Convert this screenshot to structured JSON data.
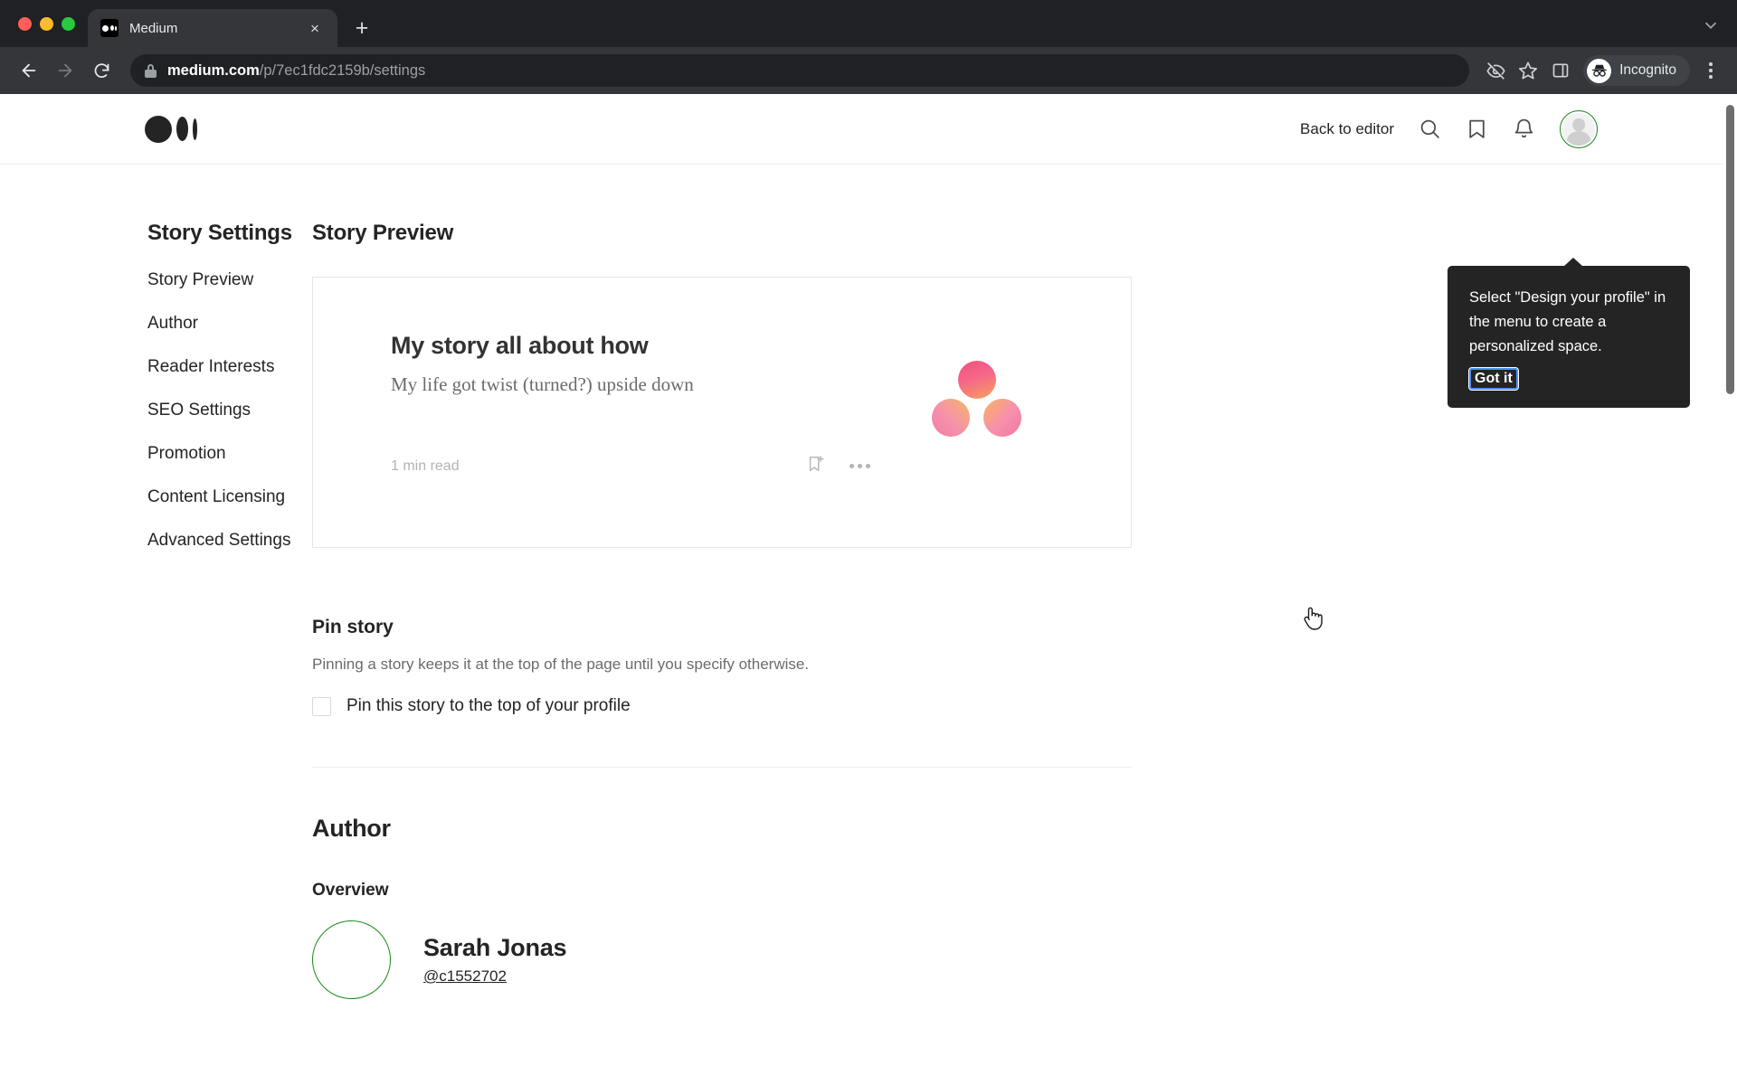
{
  "browser": {
    "tab": {
      "title": "Medium",
      "favicon": "medium-favicon",
      "close": "×"
    },
    "new_tab": "+",
    "tab_list_chevron": "⌄",
    "nav": {
      "back": "←",
      "forward": "→",
      "reload": "⟳"
    },
    "url": {
      "host": "medium.com",
      "path": "/p/7ec1fdc2159b/settings",
      "lock": "lock-icon"
    },
    "right_icons": [
      "eye-slash-icon",
      "star-icon",
      "side-panel-icon"
    ],
    "incognito_label": "Incognito",
    "menu": "kebab-menu"
  },
  "header": {
    "logo": "medium-logo",
    "back_to_editor": "Back to editor",
    "icons": [
      "search-icon",
      "bookmark-icon",
      "notifications-bell-icon"
    ],
    "avatar": "user-avatar"
  },
  "tooltip": {
    "text": "Select \"Design your profile\" in the menu to create a personalized space.",
    "button": "Got it",
    "bg_color": "#242424",
    "focus_ring_color": "#4d90fe"
  },
  "sidebar": {
    "title": "Story Settings",
    "items": [
      {
        "label": "Story Preview"
      },
      {
        "label": "Author"
      },
      {
        "label": "Reader Interests"
      },
      {
        "label": "SEO Settings"
      },
      {
        "label": "Promotion"
      },
      {
        "label": "Content Licensing"
      },
      {
        "label": "Advanced Settings"
      }
    ]
  },
  "main": {
    "story_preview": {
      "section_title": "Story Preview",
      "card": {
        "title": "My story all about how",
        "subtitle": "My life got twist (turned?) upside down",
        "read_time": "1 min read",
        "bookmark_icon": "bookmark-plus-icon",
        "more_icon": "more-options-icon",
        "thumbnail": "three-gradient-circles"
      }
    },
    "pin_story": {
      "title": "Pin story",
      "description": "Pinning a story keeps it at the top of the page until you specify otherwise.",
      "checkbox_label": "Pin this story to the top of your profile",
      "checked": false
    },
    "author": {
      "title": "Author",
      "overview_label": "Overview",
      "name": "Sarah Jonas",
      "handle": "@c1552702",
      "avatar": "author-avatar",
      "ring_color": "#1a8917"
    }
  },
  "cursor": {
    "type": "pointer-hand"
  }
}
